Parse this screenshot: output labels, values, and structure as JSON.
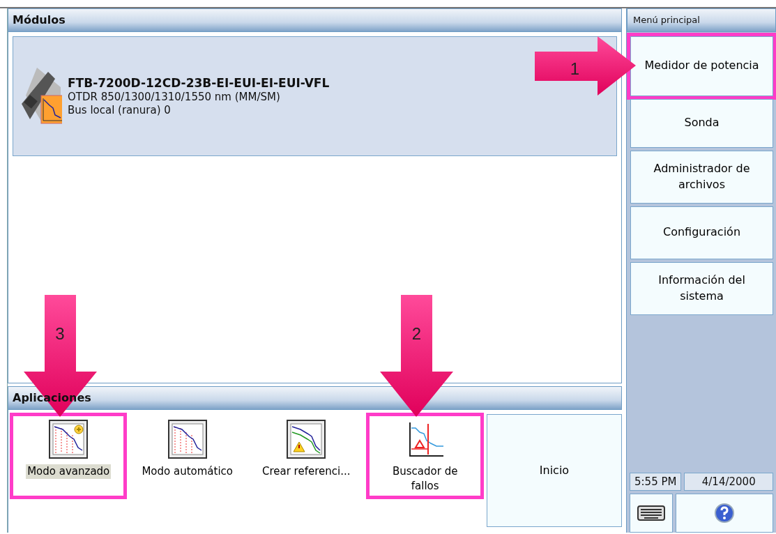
{
  "modules_panel": {
    "title": "Módulos",
    "module": {
      "name": "FTB-7200D-12CD-23B-EI-EUI-EI-EUI-VFL",
      "description": "OTDR 850/1300/1310/1550 nm (MM/SM)",
      "location": "Bus local (ranura) 0"
    }
  },
  "applications_panel": {
    "title": "Aplicaciones",
    "items": [
      {
        "kind": "app",
        "label": "Modo avanzado",
        "selected": true,
        "highlighted": true,
        "callout": "3"
      },
      {
        "kind": "app",
        "label": "Modo automático",
        "selected": false,
        "highlighted": false
      },
      {
        "kind": "app",
        "label": "Crear referenci...",
        "selected": false,
        "highlighted": false
      },
      {
        "kind": "app",
        "label": "Buscador de fallos",
        "selected": false,
        "highlighted": true,
        "callout": "2"
      },
      {
        "kind": "button",
        "label": "Inicio"
      }
    ]
  },
  "main_menu": {
    "title": "Menú principal",
    "items": [
      {
        "label": "Medidor de potencia",
        "highlighted": true,
        "callout": "1"
      },
      {
        "label": "Sonda",
        "highlighted": false
      },
      {
        "label": "Administrador de archivos",
        "highlighted": false
      },
      {
        "label": "Configuración",
        "highlighted": false
      },
      {
        "label": "Información del sistema",
        "highlighted": false
      }
    ]
  },
  "status_bar": {
    "time": "5:55 PM",
    "date": "4/14/2000"
  }
}
